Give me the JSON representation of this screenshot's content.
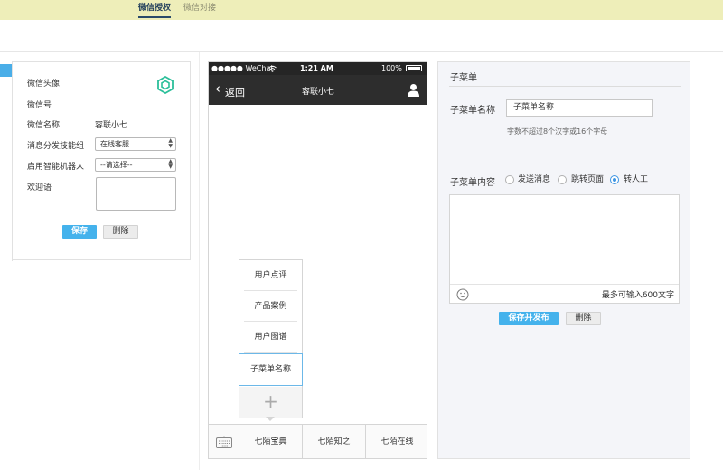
{
  "top_tabs": [
    {
      "label": "微信授权",
      "active": true
    },
    {
      "label": "微信对接",
      "active": false
    }
  ],
  "left_panel": {
    "fields": [
      {
        "label": "微信头像"
      },
      {
        "label": "微信号"
      },
      {
        "label": "微信名称",
        "value": "容联小七"
      },
      {
        "label": "消息分发技能组",
        "select": "在线客服"
      },
      {
        "label": "启用智能机器人",
        "select": "--请选择--"
      },
      {
        "label": "欢迎语"
      }
    ],
    "save_button": "保存",
    "delete_button": "删除"
  },
  "phone": {
    "status_carrier": "●●●●● WeChat",
    "status_time": "1:21 AM",
    "status_battery": "100%",
    "back_label": "返回",
    "title": "容联小七",
    "submenu_items": [
      "用户点评",
      "产品案例",
      "用户图谱"
    ],
    "submenu_active": "子菜单名称",
    "add_symbol": "+",
    "bottom_menu": [
      "七陌宝典",
      "七陌知之",
      "七陌在线"
    ]
  },
  "right_panel": {
    "title": "子菜单",
    "name_label": "子菜单名称",
    "name_value": "子菜单名称",
    "name_hint": "字数不超过8个汉字或16个字母",
    "content_label": "子菜单内容",
    "radio_options": [
      {
        "label": "发送消息",
        "checked": false
      },
      {
        "label": "跳转页面",
        "checked": false
      },
      {
        "label": "转人工",
        "checked": true
      }
    ],
    "char_limit": "最多可输入600文字",
    "publish_button": "保存并发布",
    "delete_button": "删除"
  },
  "colors": {
    "top_bar": "#eeeeb9",
    "accent_blue": "#44b2ec",
    "nav_dark": "#2d2d2d"
  }
}
